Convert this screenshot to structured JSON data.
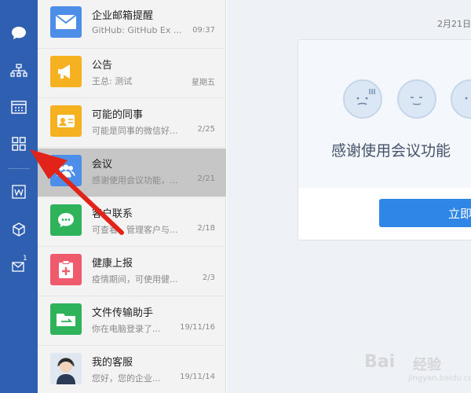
{
  "sidebar": {
    "icons": [
      "chat-bubble-icon",
      "org-chart-icon",
      "calendar-icon",
      "apps-grid-icon",
      "doc-w-icon",
      "cube-icon",
      "mail-icon"
    ],
    "mail_badge": "1"
  },
  "conversations": [
    {
      "title": "企业邮箱提醒",
      "preview": "GitHub: GitHub Ex ...",
      "time": "09:37",
      "icon": "mail-icon",
      "color": "#4d8fe8"
    },
    {
      "title": "公告",
      "preview": "王总: 测试",
      "time": "星期五",
      "icon": "megaphone-icon",
      "color": "#f6b121"
    },
    {
      "title": "可能的同事",
      "preview": "可能是同事的微信好...",
      "time": "2/25",
      "icon": "contact-card-icon",
      "color": "#f6b121"
    },
    {
      "title": "会议",
      "preview": "感谢使用会议功能，...",
      "time": "2/21",
      "icon": "meeting-people-icon",
      "color": "#4d8fe8",
      "active": true
    },
    {
      "title": "客户联系",
      "preview": "可查看、管理客户与...",
      "time": "2/18",
      "icon": "wechat-icon",
      "color": "#2fb35a"
    },
    {
      "title": "健康上报",
      "preview": "疫情期间，可使用健...",
      "time": "2/3",
      "icon": "health-report-icon",
      "color": "#ef5a6c"
    },
    {
      "title": "文件传输助手",
      "preview": "你在电脑登录了...",
      "time": "19/11/16",
      "icon": "folder-transfer-icon",
      "color": "#2fb35a"
    },
    {
      "title": "我的客服",
      "preview": "您好，您的企业...",
      "time": "19/11/14",
      "icon": "service-agent-avatar",
      "color": "#dfe8f0"
    }
  ],
  "main": {
    "date": "2月21日",
    "card_heading": "感谢使用会议功能",
    "cta_label": "立即"
  },
  "watermark": {
    "brand": "Bai",
    "brand2": "经验",
    "url": "jingyan.baidu.com"
  },
  "colors": {
    "rail": "#2f5fb0",
    "arrow": "#e2231a",
    "cta": "#2f86e6"
  }
}
